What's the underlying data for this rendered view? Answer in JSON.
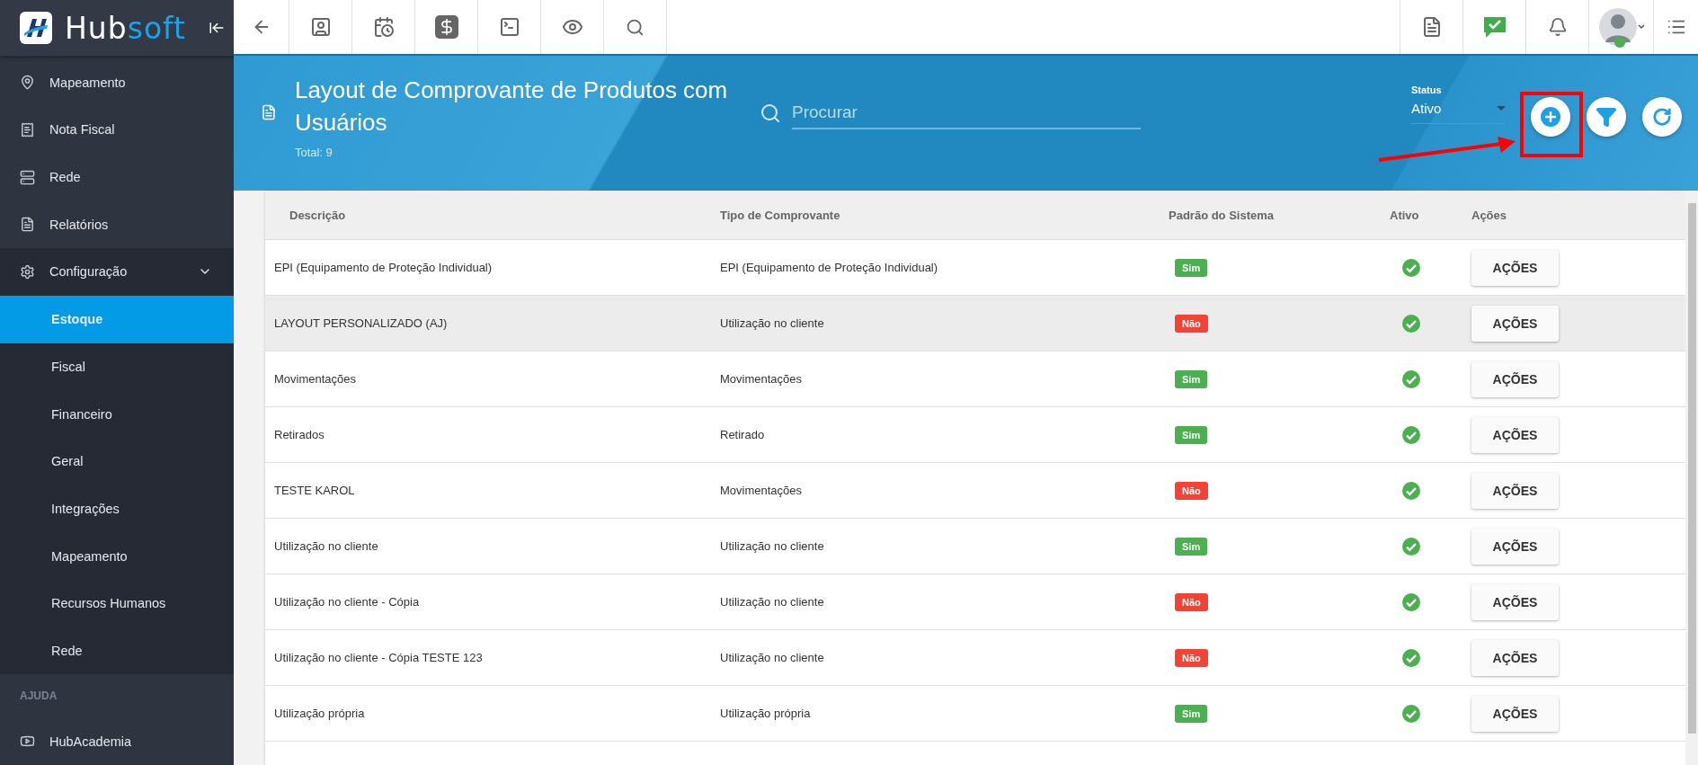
{
  "brand": {
    "name_a": "Hub",
    "name_b": "soft"
  },
  "sidebar": {
    "items": [
      {
        "label": "Mapeamento"
      },
      {
        "label": "Nota Fiscal"
      },
      {
        "label": "Rede"
      },
      {
        "label": "Relatórios"
      },
      {
        "label": "Configuração",
        "expanded": true,
        "children": [
          {
            "label": "Estoque",
            "selected": true
          },
          {
            "label": "Fiscal",
            "selected": false
          },
          {
            "label": "Financeiro",
            "selected": false
          },
          {
            "label": "Geral",
            "selected": false
          },
          {
            "label": "Integrações",
            "selected": false
          },
          {
            "label": "Mapeamento",
            "selected": false
          },
          {
            "label": "Recursos Humanos",
            "selected": false
          },
          {
            "label": "Rede",
            "selected": false
          }
        ]
      }
    ],
    "section": "AJUDA",
    "help_items": [
      {
        "label": "HubAcademia"
      }
    ]
  },
  "page": {
    "title": "Layout de Comprovante de Produtos com Usuários",
    "total": "Total: 9",
    "search": {
      "placeholder": "Procurar"
    },
    "status": {
      "label": "Status",
      "value": "Ativo"
    },
    "add_button": {
      "highlighted": true
    }
  },
  "table": {
    "columns": [
      "Descrição",
      "Tipo de Comprovante",
      "Padrão do Sistema",
      "Ativo",
      "Ações"
    ],
    "rows": [
      {
        "descricao": "EPI (Equipamento de Proteção Individual)",
        "tipo": "EPI (Equipamento de Proteção Individual)",
        "padrao": "Sim",
        "padrao_on": true,
        "ativo": true,
        "acao": "AÇÕES",
        "hovered": false
      },
      {
        "descricao": "LAYOUT PERSONALIZADO (AJ)",
        "tipo": "Utilização no cliente",
        "padrao": "Não",
        "padrao_on": false,
        "ativo": true,
        "acao": "AÇÕES",
        "hovered": true
      },
      {
        "descricao": "Movimentações",
        "tipo": "Movimentações",
        "padrao": "Sim",
        "padrao_on": true,
        "ativo": true,
        "acao": "AÇÕES",
        "hovered": false
      },
      {
        "descricao": "Retirados",
        "tipo": "Retirado",
        "padrao": "Sim",
        "padrao_on": true,
        "ativo": true,
        "acao": "AÇÕES",
        "hovered": false
      },
      {
        "descricao": "TESTE KAROL",
        "tipo": "Movimentações",
        "padrao": "Não",
        "padrao_on": false,
        "ativo": true,
        "acao": "AÇÕES",
        "hovered": false
      },
      {
        "descricao": "Utilização no cliente",
        "tipo": "Utilização no cliente",
        "padrao": "Sim",
        "padrao_on": true,
        "ativo": true,
        "acao": "AÇÕES",
        "hovered": false
      },
      {
        "descricao": "Utilização no cliente - Cópia",
        "tipo": "Utilização no cliente",
        "padrao": "Não",
        "padrao_on": false,
        "ativo": true,
        "acao": "AÇÕES",
        "hovered": false
      },
      {
        "descricao": "Utilização no cliente - Cópia TESTE 123",
        "tipo": "Utilização no cliente",
        "padrao": "Não",
        "padrao_on": false,
        "ativo": true,
        "acao": "AÇÕES",
        "hovered": false
      },
      {
        "descricao": "Utilização própria",
        "tipo": "Utilização própria",
        "padrao": "Sim",
        "padrao_on": true,
        "ativo": true,
        "acao": "AÇÕES",
        "hovered": false
      }
    ]
  }
}
